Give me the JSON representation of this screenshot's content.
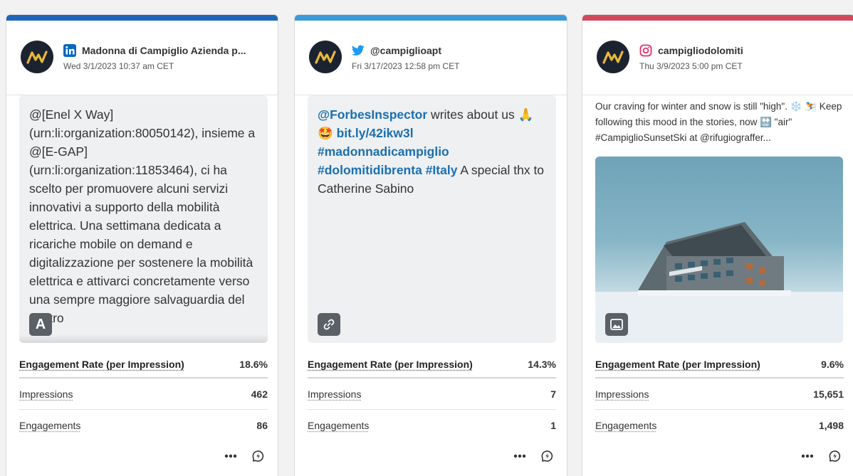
{
  "colors": {
    "linkedin_accent": "#1e67b8",
    "twitter_accent": "#3c9ad8",
    "instagram_accent": "#d2495f",
    "link_text": "#1b6fb0"
  },
  "cards": [
    {
      "network": "linkedin",
      "network_icon": "linkedin-icon",
      "account": "Madonna di Campiglio Azienda p...",
      "date": "Wed 3/1/2023 10:37 am CET",
      "text": "@[Enel X Way] (urn:li:organization:80050142), insieme a @[E-GAP] (urn:li:organization:11853464), ci ha scelto per promuovere alcuni servizi innovativi a supporto della mobilità elettrica. Una settimana dedicata a ricariche mobile on demand e digitalizzazione per sostenere la mobilità elettrica e attivarci concretamente verso una sempre maggiore salvaguardia del nostro",
      "badge": "A",
      "metrics": [
        {
          "label": "Engagement Rate (per Impression)",
          "value": "18.6%"
        },
        {
          "label": "Impressions",
          "value": "462"
        },
        {
          "label": "Engagements",
          "value": "86"
        }
      ]
    },
    {
      "network": "twitter",
      "network_icon": "twitter-bird-icon",
      "account": "@campiglioapt",
      "date": "Fri 3/17/2023 12:58 pm CET",
      "text_parts": [
        {
          "text": "@ForbesInspector",
          "link": true
        },
        {
          "text": " writes about us 🙏\n🤩 ",
          "link": false
        },
        {
          "text": "bit.ly/42ikw3l",
          "link": true
        },
        {
          "text": "\n",
          "link": false
        },
        {
          "text": "#madonnadicampiglio",
          "link": true
        },
        {
          "text": "\n",
          "link": false
        },
        {
          "text": "#dolomitidibrenta",
          "link": true
        },
        {
          "text": " ",
          "link": false
        },
        {
          "text": "#Italy",
          "link": true
        },
        {
          "text": " A special thx to Catherine Sabino",
          "link": false
        }
      ],
      "metrics": [
        {
          "label": "Engagement Rate (per Impression)",
          "value": "14.3%"
        },
        {
          "label": "Impressions",
          "value": "7"
        },
        {
          "label": "Engagements",
          "value": "1"
        }
      ]
    },
    {
      "network": "instagram",
      "network_icon": "instagram-icon",
      "account": "campigliodolomiti",
      "date": "Thu 3/9/2023 5:00 pm CET",
      "caption": "Our craving for winter and snow is still \"high\". ❄️ ⛷️ Keep following this mood in the stories, now 🔛 \"air\" #CampiglioSunsetSki at @rifugiograffer...",
      "metrics": [
        {
          "label": "Engagement Rate (per Impression)",
          "value": "9.6%"
        },
        {
          "label": "Impressions",
          "value": "15,651"
        },
        {
          "label": "Engagements",
          "value": "1,498"
        }
      ]
    }
  ]
}
